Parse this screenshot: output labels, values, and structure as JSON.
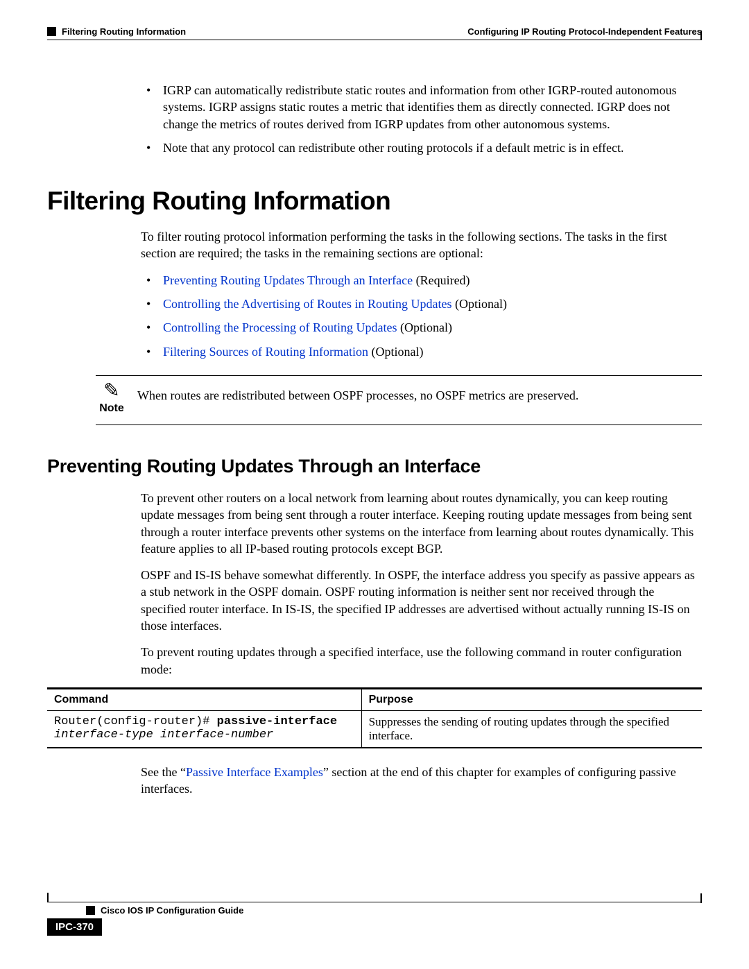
{
  "header": {
    "breadcrumb_left": "Filtering Routing Information",
    "breadcrumb_right": "Configuring IP Routing Protocol-Independent Features"
  },
  "intro_bullets": [
    "IGRP can automatically redistribute static routes and information from other IGRP-routed autonomous systems. IGRP assigns static routes a metric that identifies them as directly connected. IGRP does not change the metrics of routes derived from IGRP updates from other autonomous systems.",
    "Note that any protocol can redistribute other routing protocols if a default metric is in effect."
  ],
  "section": {
    "title": "Filtering Routing Information",
    "intro": "To filter routing protocol information performing the tasks in the following sections. The tasks in the first section are required; the tasks in the remaining sections are optional:",
    "tasks": [
      {
        "link": "Preventing Routing Updates Through an Interface",
        "suffix": " (Required)"
      },
      {
        "link": "Controlling the Advertising of Routes in Routing Updates",
        "suffix": " (Optional)"
      },
      {
        "link": "Controlling the Processing of Routing Updates",
        "suffix": " (Optional)"
      },
      {
        "link": "Filtering Sources of Routing Information",
        "suffix": " (Optional)"
      }
    ],
    "note_label": "Note",
    "note_text": "When routes are redistributed between OSPF processes, no OSPF metrics are preserved."
  },
  "subsection": {
    "title": "Preventing Routing Updates Through an Interface",
    "paras": [
      "To prevent other routers on a local network from learning about routes dynamically, you can keep routing update messages from being sent through a router interface. Keeping routing update messages from being sent through a router interface prevents other systems on the interface from learning about routes dynamically. This feature applies to all IP-based routing protocols except BGP.",
      "OSPF and IS-IS behave somewhat differently. In OSPF, the interface address you specify as passive appears as a stub network in the OSPF domain. OSPF routing information is neither sent nor received through the specified router interface. In IS-IS, the specified IP addresses are advertised without actually running IS-IS on those interfaces.",
      "To prevent routing updates through a specified interface, use the following command in router configuration mode:"
    ],
    "table": {
      "headers": {
        "command": "Command",
        "purpose": "Purpose"
      },
      "row": {
        "cmd_prefix": "Router(config-router)# ",
        "cmd_bold": "passive-interface",
        "cmd_args": "interface-type interface-number",
        "purpose": "Suppresses the sending of routing updates through the specified interface."
      }
    },
    "closing_pre": "See the “",
    "closing_link": "Passive Interface Examples",
    "closing_post": "” section at the end of this chapter for examples of configuring passive interfaces."
  },
  "footer": {
    "guide": "Cisco IOS IP Configuration Guide",
    "page": "IPC-370"
  }
}
